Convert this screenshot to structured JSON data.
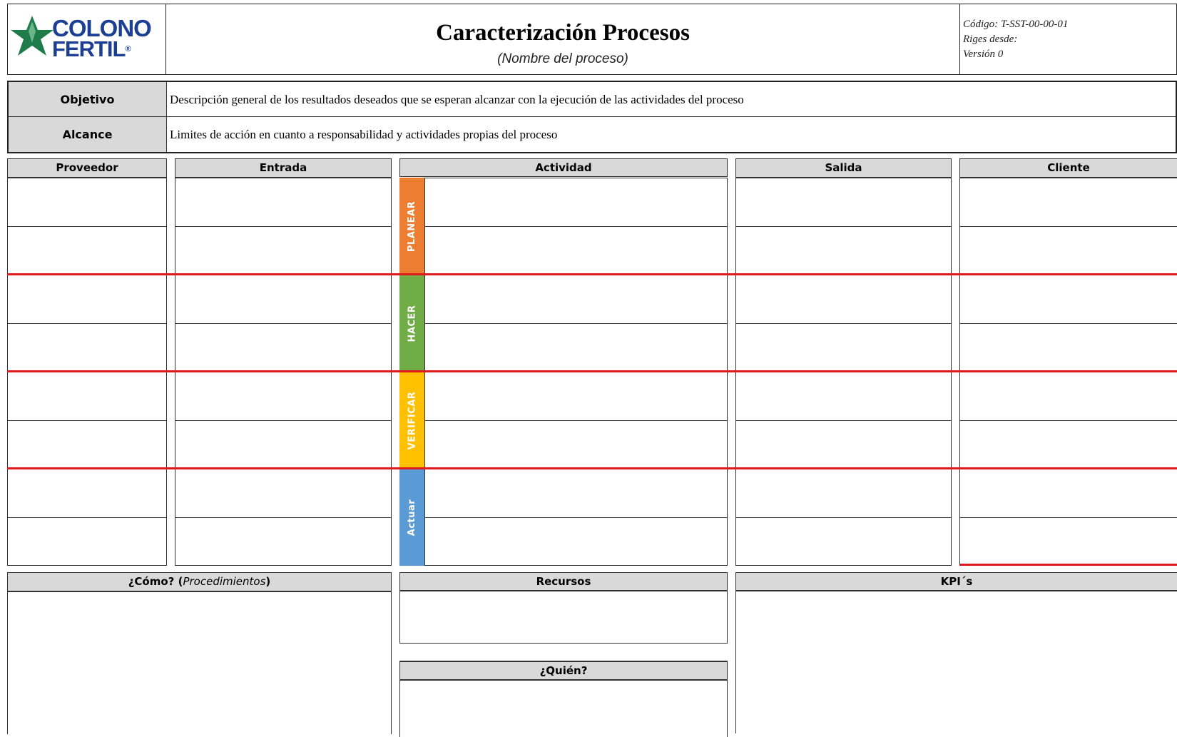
{
  "header": {
    "logo_line1": "COLONO",
    "logo_line2": "FERTIL",
    "logo_mark": "®",
    "title": "Caracterización Procesos",
    "subtitle": "(Nombre del proceso)",
    "meta": [
      "Código: T-SST-00-00-01",
      "Riges desde:",
      "Versión 0"
    ]
  },
  "info": {
    "objetivo_label": "Objetivo",
    "objetivo_text": "Descripción general de los resultados deseados que se esperan alcanzar con la ejecución de las actividades del proceso",
    "alcance_label": "Alcance",
    "alcance_text": "Limites de acción en cuanto a responsabilidad y actividades propias del proceso"
  },
  "columns": {
    "proveedor": "Proveedor",
    "entrada": "Entrada",
    "actividad": "Actividad",
    "salida": "Salida",
    "cliente": "Cliente"
  },
  "phases": [
    {
      "label": "PLANEAR",
      "color": "#ed7d31"
    },
    {
      "label": "HACER",
      "color": "#70ad47"
    },
    {
      "label": "VERIFICAR",
      "color": "#ffc000"
    },
    {
      "label": "Actuar",
      "color": "#5b9bd5"
    }
  ],
  "bottom": {
    "como_label": "¿Cómo? (",
    "como_italic": "Procedimientos",
    "como_close": ")",
    "recursos_label": "Recursos",
    "quien_label": "¿Quién?",
    "kpi_label": "KPI´s"
  },
  "colors": {
    "header_gray": "#d9d9d9",
    "divider_red": "#e0191f",
    "logo_green": "#1e7b4a",
    "logo_blue": "#1c3f94"
  }
}
